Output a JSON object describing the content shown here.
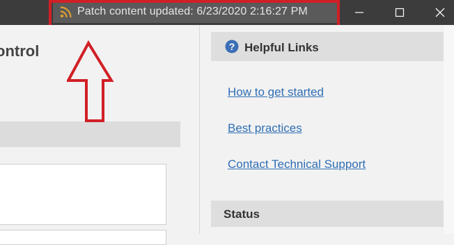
{
  "titlebar": {
    "patch_status": "Patch content updated: 6/23/2020 2:16:27 PM",
    "feed_icon": "rss-feed-icon",
    "controls": [
      "minimize-icon",
      "maximize-icon",
      "close-icon"
    ]
  },
  "main": {
    "heading_fragment": "ontrol"
  },
  "help": {
    "title": "Helpful Links",
    "icon": "question-circle-icon",
    "links": [
      {
        "label": "How to get started"
      },
      {
        "label": "Best practices"
      },
      {
        "label": "Contact Technical Support"
      }
    ]
  },
  "status": {
    "title": "Status"
  },
  "colors": {
    "titlebar": "#3c3c3c",
    "highlight": "#d11f26",
    "link": "#2f6eb5",
    "feed": "#e0a030"
  }
}
